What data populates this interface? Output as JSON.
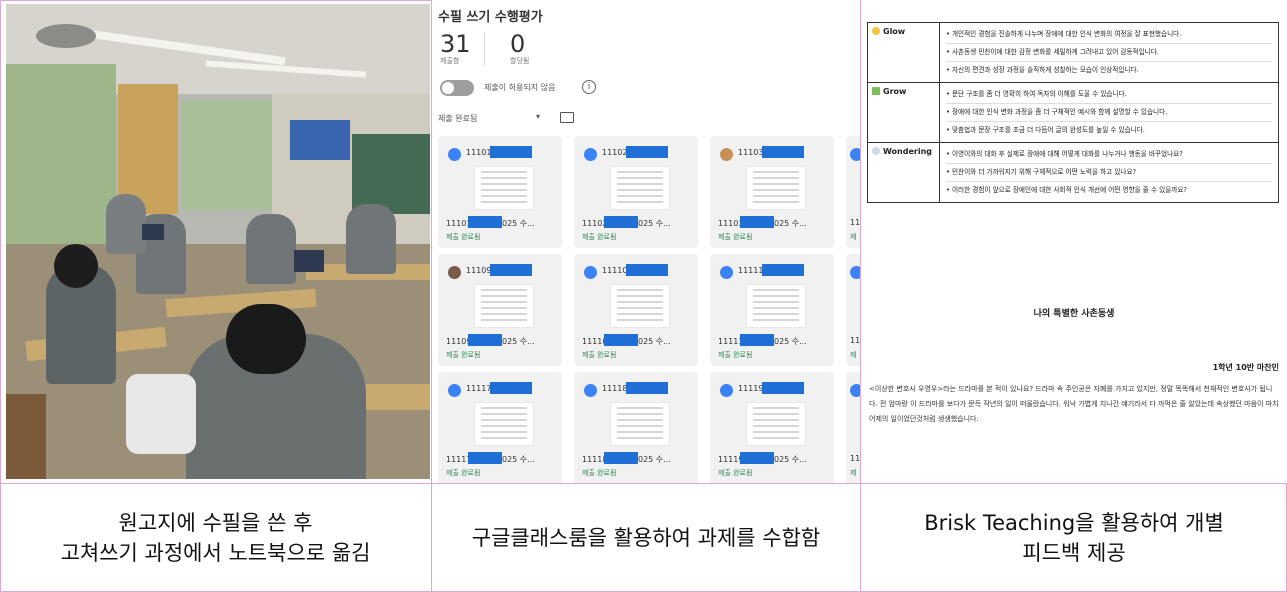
{
  "captions": {
    "panel1": [
      "원고지에 수필을 쓴 후",
      "고쳐쓰기 과정에서 노트북으로 옮김"
    ],
    "panel2": "구글클래스룸을 활용하여 과제를 수합함",
    "panel3": [
      "Brisk Teaching을 활용하여 개별",
      "피드백 제공"
    ]
  },
  "classroom": {
    "title": "수필 쓰기 수행평가",
    "submitted_count": "31",
    "submitted_label": "제출함",
    "assigned_count": "0",
    "assigned_label": "할당됨",
    "toggle_label": "제출이 허용되지 않음",
    "filter_label": "제출 완료됨",
    "cards": [
      {
        "id": "11101",
        "file": "11101",
        "year": "2025 수...",
        "status": "제출 완료됨",
        "avatar": "default"
      },
      {
        "id": "11102",
        "file": "11102",
        "year": "2025 수...",
        "status": "제출 완료됨",
        "avatar": "default"
      },
      {
        "id": "11103",
        "file": "11103",
        "year": "2025 수...",
        "status": "제출 완료됨",
        "avatar": "photo"
      },
      {
        "id": "11109",
        "file": "11109",
        "year": "2025 수...",
        "status": "제출 완료됨",
        "avatar": "photo2"
      },
      {
        "id": "11110",
        "file": "11110",
        "year": "2025 수...",
        "status": "제출 완료됨",
        "avatar": "default"
      },
      {
        "id": "11111",
        "file": "11111",
        "year": "2025 수...",
        "status": "제출 완료됨",
        "avatar": "default"
      },
      {
        "id": "11117",
        "file": "11117",
        "year": "2025 수...",
        "status": "제출 완료됨",
        "avatar": "default"
      },
      {
        "id": "11118",
        "file": "11118",
        "year": "2025 수...",
        "status": "제출 완료됨",
        "avatar": "default"
      },
      {
        "id": "11119",
        "file": "11119",
        "year": "2025 수...",
        "status": "제출 완료됨",
        "avatar": "default"
      }
    ],
    "edge_cards": [
      {
        "id": "11",
        "status": "제"
      },
      {
        "id": "11",
        "status": "제"
      },
      {
        "id": "11",
        "status": "제"
      }
    ]
  },
  "feedback": {
    "rows": [
      {
        "label": "Glow",
        "icon": "sun-icon",
        "items": [
          "• 개인적인 경험을 진솔하게 나누며 장애에 대한 인식 변화의 여정을 잘 표현했습니다.",
          "• 사촌동생 민찬이에 대한 감정 변화를 세밀하게 그려내고 있어 감동적입니다.",
          "• 자신의 편견과 성장 과정을 솔직하게 성찰하는 모습이 인상적입니다."
        ]
      },
      {
        "label": "Grow",
        "icon": "sprout-icon",
        "items": [
          "• 문단 구조를 좀 더 명확히 하여 독자의 이해를 도울 수 있습니다.",
          "• 장애에 대한 인식 변화 과정을 좀 더 구체적인 예시와 함께 설명할 수 있습니다.",
          "• 맞춤법과 문장 구조를 조금 더 다듬어 글의 완성도를 높일 수 있습니다."
        ]
      },
      {
        "label": "Wondering",
        "icon": "thought-bubble-icon",
        "items": [
          "• 이영이와의 대화 후 실제로 장애에 대해 어떻게 대화를 나누거나 행동을 바꾸었나요?",
          "• 민찬이와 더 가까워지기 위해 구체적으로 어떤 노력을 하고 있나요?",
          "• 이러한 경험이 앞으로 장애인에 대한 사회적 인식 개선에 어떤 영향을 줄 수 있을까요?"
        ]
      }
    ],
    "essay_title": "나의 특별한 사촌동생",
    "author": "1학년 10반 마찬민",
    "body": "<이상한 변호사 우영우>라는 드라마를 본 적이 있나요? 드라마 속 주인공은 자폐를 가지고 있지만, 정말 똑똑해서 천재적인 변호사가 됩니다. 전 엄마랑 이 드라마를 보다가 문득 작년의 일이 떠올랐습니다. 워낙 가볍게 지나간 얘기라서 다 까먹은 줄 알았는데 속상했던 마음이 마치 어제의 일이었던것처럼 생생했습니다."
  }
}
